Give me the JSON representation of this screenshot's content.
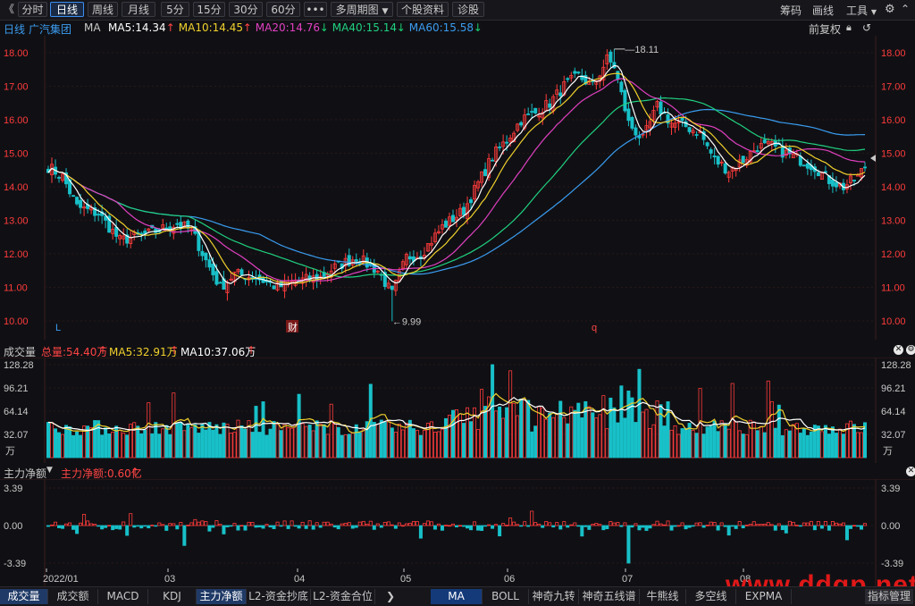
{
  "toolbar": {
    "back_glyph": "《",
    "periods": [
      "分时",
      "日线",
      "周线",
      "月线",
      "5分",
      "15分",
      "30分",
      "60分"
    ],
    "active": "日线",
    "more": "•••",
    "multi_period": "多周期图",
    "stock_profile": "个股资料",
    "diagnose": "诊股",
    "right_menu": [
      "筹码",
      "画线",
      "工具"
    ],
    "window_controls": [
      "gear-icon",
      "minimize-icon",
      "maximize-icon",
      "close-icon"
    ]
  },
  "ma_header": {
    "period": "日线",
    "stock_name": "广汽集团",
    "indicator": "MA",
    "items": [
      {
        "label": "MA5:14.34",
        "color": "#ffffff",
        "arrow": "↑",
        "arrow_color": "#ff4444"
      },
      {
        "label": "MA10:14.45",
        "color": "#f0d02c",
        "arrow": "↑",
        "arrow_color": "#ff4444"
      },
      {
        "label": "MA20:14.76",
        "color": "#e040c0",
        "arrow": "↓",
        "arrow_color": "#18d070"
      },
      {
        "label": "MA40:15.14",
        "color": "#20d080",
        "arrow": "↓",
        "arrow_color": "#18d070"
      },
      {
        "label": "MA60:15.58",
        "color": "#3a9cf0",
        "arrow": "↓",
        "arrow_color": "#18d070"
      }
    ],
    "adjust": "前复权"
  },
  "price_axis": {
    "ticks": [
      "18.00",
      "17.00",
      "16.00",
      "15.00",
      "14.00",
      "13.00",
      "12.00",
      "11.00",
      "10.00"
    ],
    "min": 9.6,
    "max": 18.4
  },
  "annotations": {
    "high": "18.11",
    "low": "9.99",
    "markers": [
      "L",
      "财",
      "q"
    ]
  },
  "volume_panel": {
    "title": "成交量",
    "total": "总量:54.40万",
    "ma5": "MA5:32.91万",
    "ma10": "MA10:37.06万",
    "ticks": [
      "128.28",
      "96.21",
      "64.14",
      "32.07"
    ],
    "unit": "万",
    "max": 128.28
  },
  "money_panel": {
    "title": "主力净额",
    "value": "主力净额:0.60亿",
    "ticks": [
      "3.39",
      "0.00",
      "-3.39"
    ]
  },
  "date_axis": [
    "2022/01",
    "03",
    "04",
    "05",
    "06",
    "07",
    "08"
  ],
  "bottom_tabs_left": [
    "成交量",
    "成交额",
    "MACD",
    "KDJ",
    "主力净额",
    "L2-资金抄底",
    "L2-资金合位"
  ],
  "bottom_tabs_right": [
    "MA",
    "BOLL",
    "神奇九转",
    "神奇五线谱",
    "牛熊线",
    "多空线",
    "EXPMA"
  ],
  "bottom_right_button": "指标管理",
  "watermark": "www.ddgp.net",
  "colors": {
    "up": "#ff3b3b",
    "down": "#18c0c8",
    "bg": "#101014",
    "grid": "#2a1a1a"
  },
  "chart_data": {
    "type": "candlestick",
    "price_range": [
      9.6,
      18.4
    ],
    "key_levels": {
      "high": 18.11,
      "low": 9.99
    },
    "close_anchors": [
      [
        0,
        14.6
      ],
      [
        4,
        14.3
      ],
      [
        8,
        13.4
      ],
      [
        14,
        13.2
      ],
      [
        20,
        12.4
      ],
      [
        28,
        12.6
      ],
      [
        36,
        12.9
      ],
      [
        40,
        12.7
      ],
      [
        44,
        11.8
      ],
      [
        48,
        11.0
      ],
      [
        52,
        11.4
      ],
      [
        58,
        11.3
      ],
      [
        64,
        11.0
      ],
      [
        70,
        11.2
      ],
      [
        76,
        11.3
      ],
      [
        80,
        11.6
      ],
      [
        86,
        11.9
      ],
      [
        92,
        11.5
      ],
      [
        96,
        10.8
      ],
      [
        100,
        11.9
      ],
      [
        104,
        12.0
      ],
      [
        110,
        12.8
      ],
      [
        116,
        13.3
      ],
      [
        120,
        14.1
      ],
      [
        124,
        14.9
      ],
      [
        128,
        15.4
      ],
      [
        132,
        16.0
      ],
      [
        136,
        16.2
      ],
      [
        140,
        16.5
      ],
      [
        144,
        17.0
      ],
      [
        148,
        17.3
      ],
      [
        152,
        17.0
      ],
      [
        156,
        17.8
      ],
      [
        158,
        17.6
      ],
      [
        162,
        15.9
      ],
      [
        166,
        15.4
      ],
      [
        170,
        16.4
      ],
      [
        174,
        15.9
      ],
      [
        178,
        15.8
      ],
      [
        182,
        15.6
      ],
      [
        186,
        14.8
      ],
      [
        190,
        14.5
      ],
      [
        194,
        14.8
      ],
      [
        198,
        15.2
      ],
      [
        202,
        15.2
      ],
      [
        206,
        15.0
      ],
      [
        210,
        14.8
      ],
      [
        214,
        14.6
      ],
      [
        218,
        14.2
      ],
      [
        222,
        14.0
      ],
      [
        226,
        14.3
      ],
      [
        228,
        14.6
      ]
    ],
    "ma_end_values": {
      "MA5": 14.34,
      "MA10": 14.45,
      "MA20": 14.76,
      "MA40": 15.14,
      "MA60": 15.58
    },
    "volume_max": 128.28,
    "money_range": [
      -3.39,
      3.39
    ]
  }
}
